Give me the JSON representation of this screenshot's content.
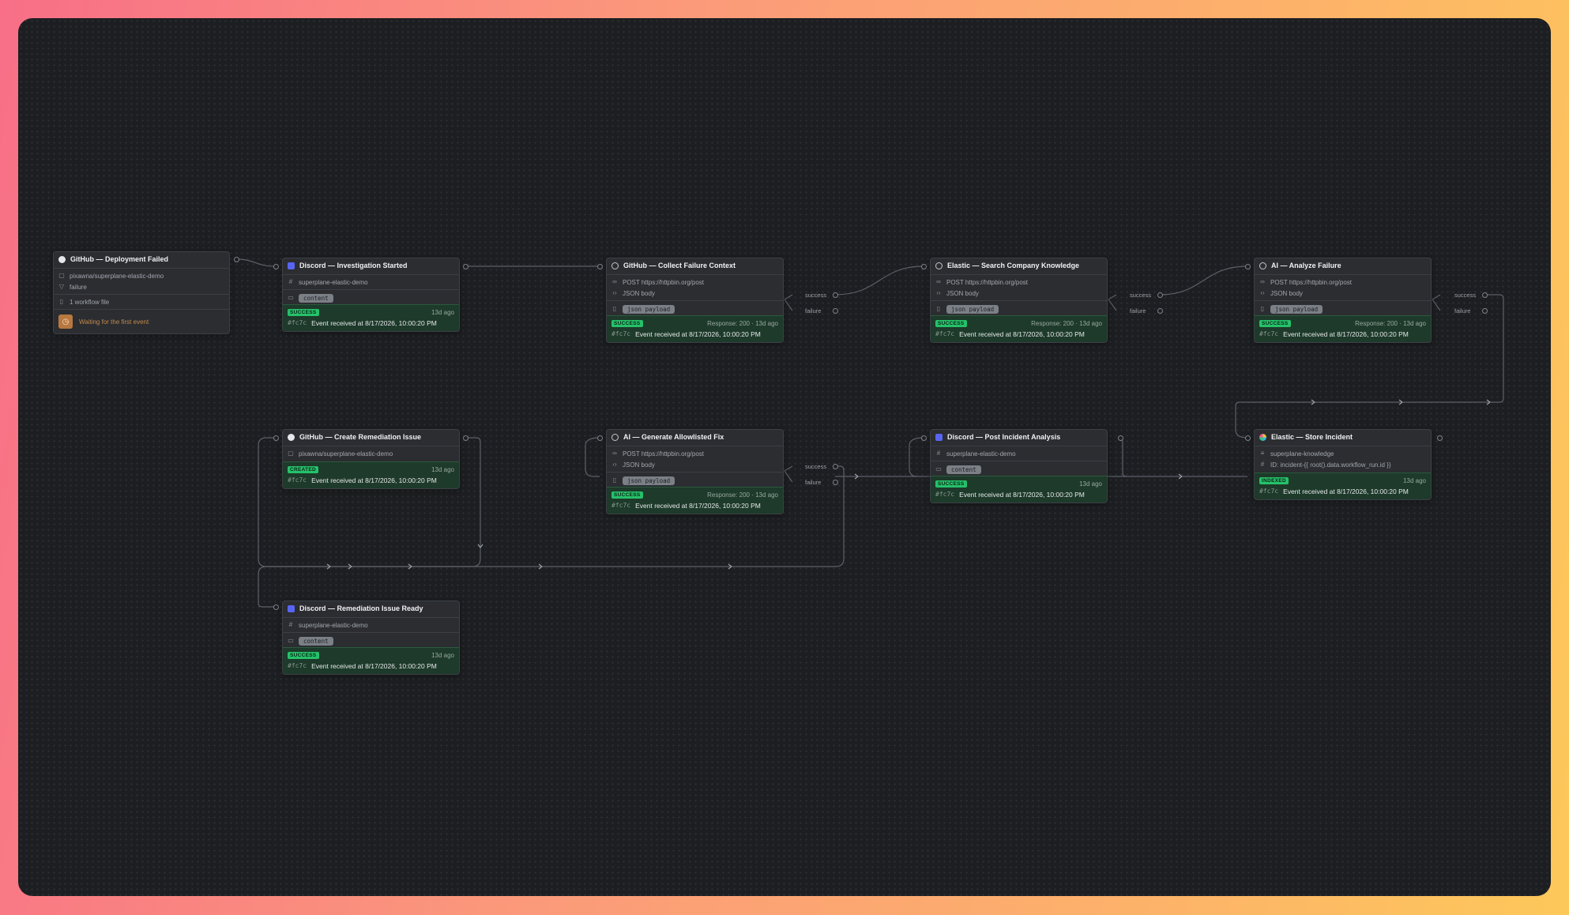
{
  "nodes": {
    "trigger": {
      "title": "GitHub — Deployment Failed",
      "repo": "pixawna/superplane-elastic-demo",
      "filter": "failure",
      "files": "1 workflow file",
      "waiting": "Waiting for the first event",
      "icon": "github-icon"
    },
    "investigation": {
      "title": "Discord — Investigation Started",
      "channel": "superplane-elastic-demo",
      "pill": "content",
      "status": "SUCCESS",
      "meta": "13d ago",
      "hash": "#fc7c",
      "event": "Event received at 8/17/2026, 10:00:20 PM",
      "icon": "discord-icon"
    },
    "collect": {
      "title": "GitHub — Collect Failure Context",
      "url": "POST https://httpbin.org/post",
      "body": "JSON body",
      "pill": "json payload",
      "status": "SUCCESS",
      "meta": "Response: 200 · 13d ago",
      "hash": "#fc7c",
      "event": "Event received at 8/17/2026, 10:00:20 PM",
      "icon": "globe-icon"
    },
    "search": {
      "title": "Elastic — Search Company Knowledge",
      "url": "POST https://httpbin.org/post",
      "body": "JSON body",
      "pill": "json payload",
      "status": "SUCCESS",
      "meta": "Response: 200 · 13d ago",
      "hash": "#fc7c",
      "event": "Event received at 8/17/2026, 10:00:20 PM",
      "icon": "globe-icon"
    },
    "analyze": {
      "title": "AI — Analyze Failure",
      "url": "POST https://httpbin.org/post",
      "body": "JSON body",
      "pill": "json payload",
      "status": "SUCCESS",
      "meta": "Response: 200 · 13d ago",
      "hash": "#fc7c",
      "event": "Event received at 8/17/2026, 10:00:20 PM",
      "icon": "globe-icon"
    },
    "remediation": {
      "title": "GitHub — Create Remediation Issue",
      "repo": "pixawna/superplane-elastic-demo",
      "status": "CREATED",
      "meta": "13d ago",
      "hash": "#fc7c",
      "event": "Event received at 8/17/2026, 10:00:20 PM",
      "icon": "github-icon"
    },
    "fix": {
      "title": "AI — Generate Allowlisted Fix",
      "url": "POST https://httpbin.org/post",
      "body": "JSON body",
      "pill": "json payload",
      "status": "SUCCESS",
      "meta": "Response: 200 · 13d ago",
      "hash": "#fc7c",
      "event": "Event received at 8/17/2026, 10:00:20 PM",
      "icon": "globe-icon"
    },
    "post": {
      "title": "Discord — Post Incident Analysis",
      "channel": "superplane-elastic-demo",
      "pill": "content",
      "status": "SUCCESS",
      "meta": "13d ago",
      "hash": "#fc7c",
      "event": "Event received at 8/17/2026, 10:00:20 PM",
      "icon": "discord-icon"
    },
    "store": {
      "title": "Elastic — Store Incident",
      "index": "superplane-knowledge",
      "id": "ID: incident-{{ root().data.workflow_run.id }}",
      "status": "INDEXED",
      "meta": "13d ago",
      "hash": "#fc7c",
      "event": "Event received at 8/17/2026, 10:00:20 PM",
      "icon": "elastic-icon"
    },
    "ready": {
      "title": "Discord — Remediation Issue Ready",
      "channel": "superplane-elastic-demo",
      "pill": "content",
      "status": "SUCCESS",
      "meta": "13d ago",
      "hash": "#fc7c",
      "event": "Event received at 8/17/2026, 10:00:20 PM",
      "icon": "discord-icon"
    }
  },
  "outputs": {
    "success": "success",
    "failure": "failure"
  },
  "colors": {
    "wire": "#5b6068",
    "success_badge": "#25c16a",
    "status_bg": "#1d3a2a",
    "node_bg": "#2b2d31",
    "canvas_bg": "#1c1e21"
  }
}
